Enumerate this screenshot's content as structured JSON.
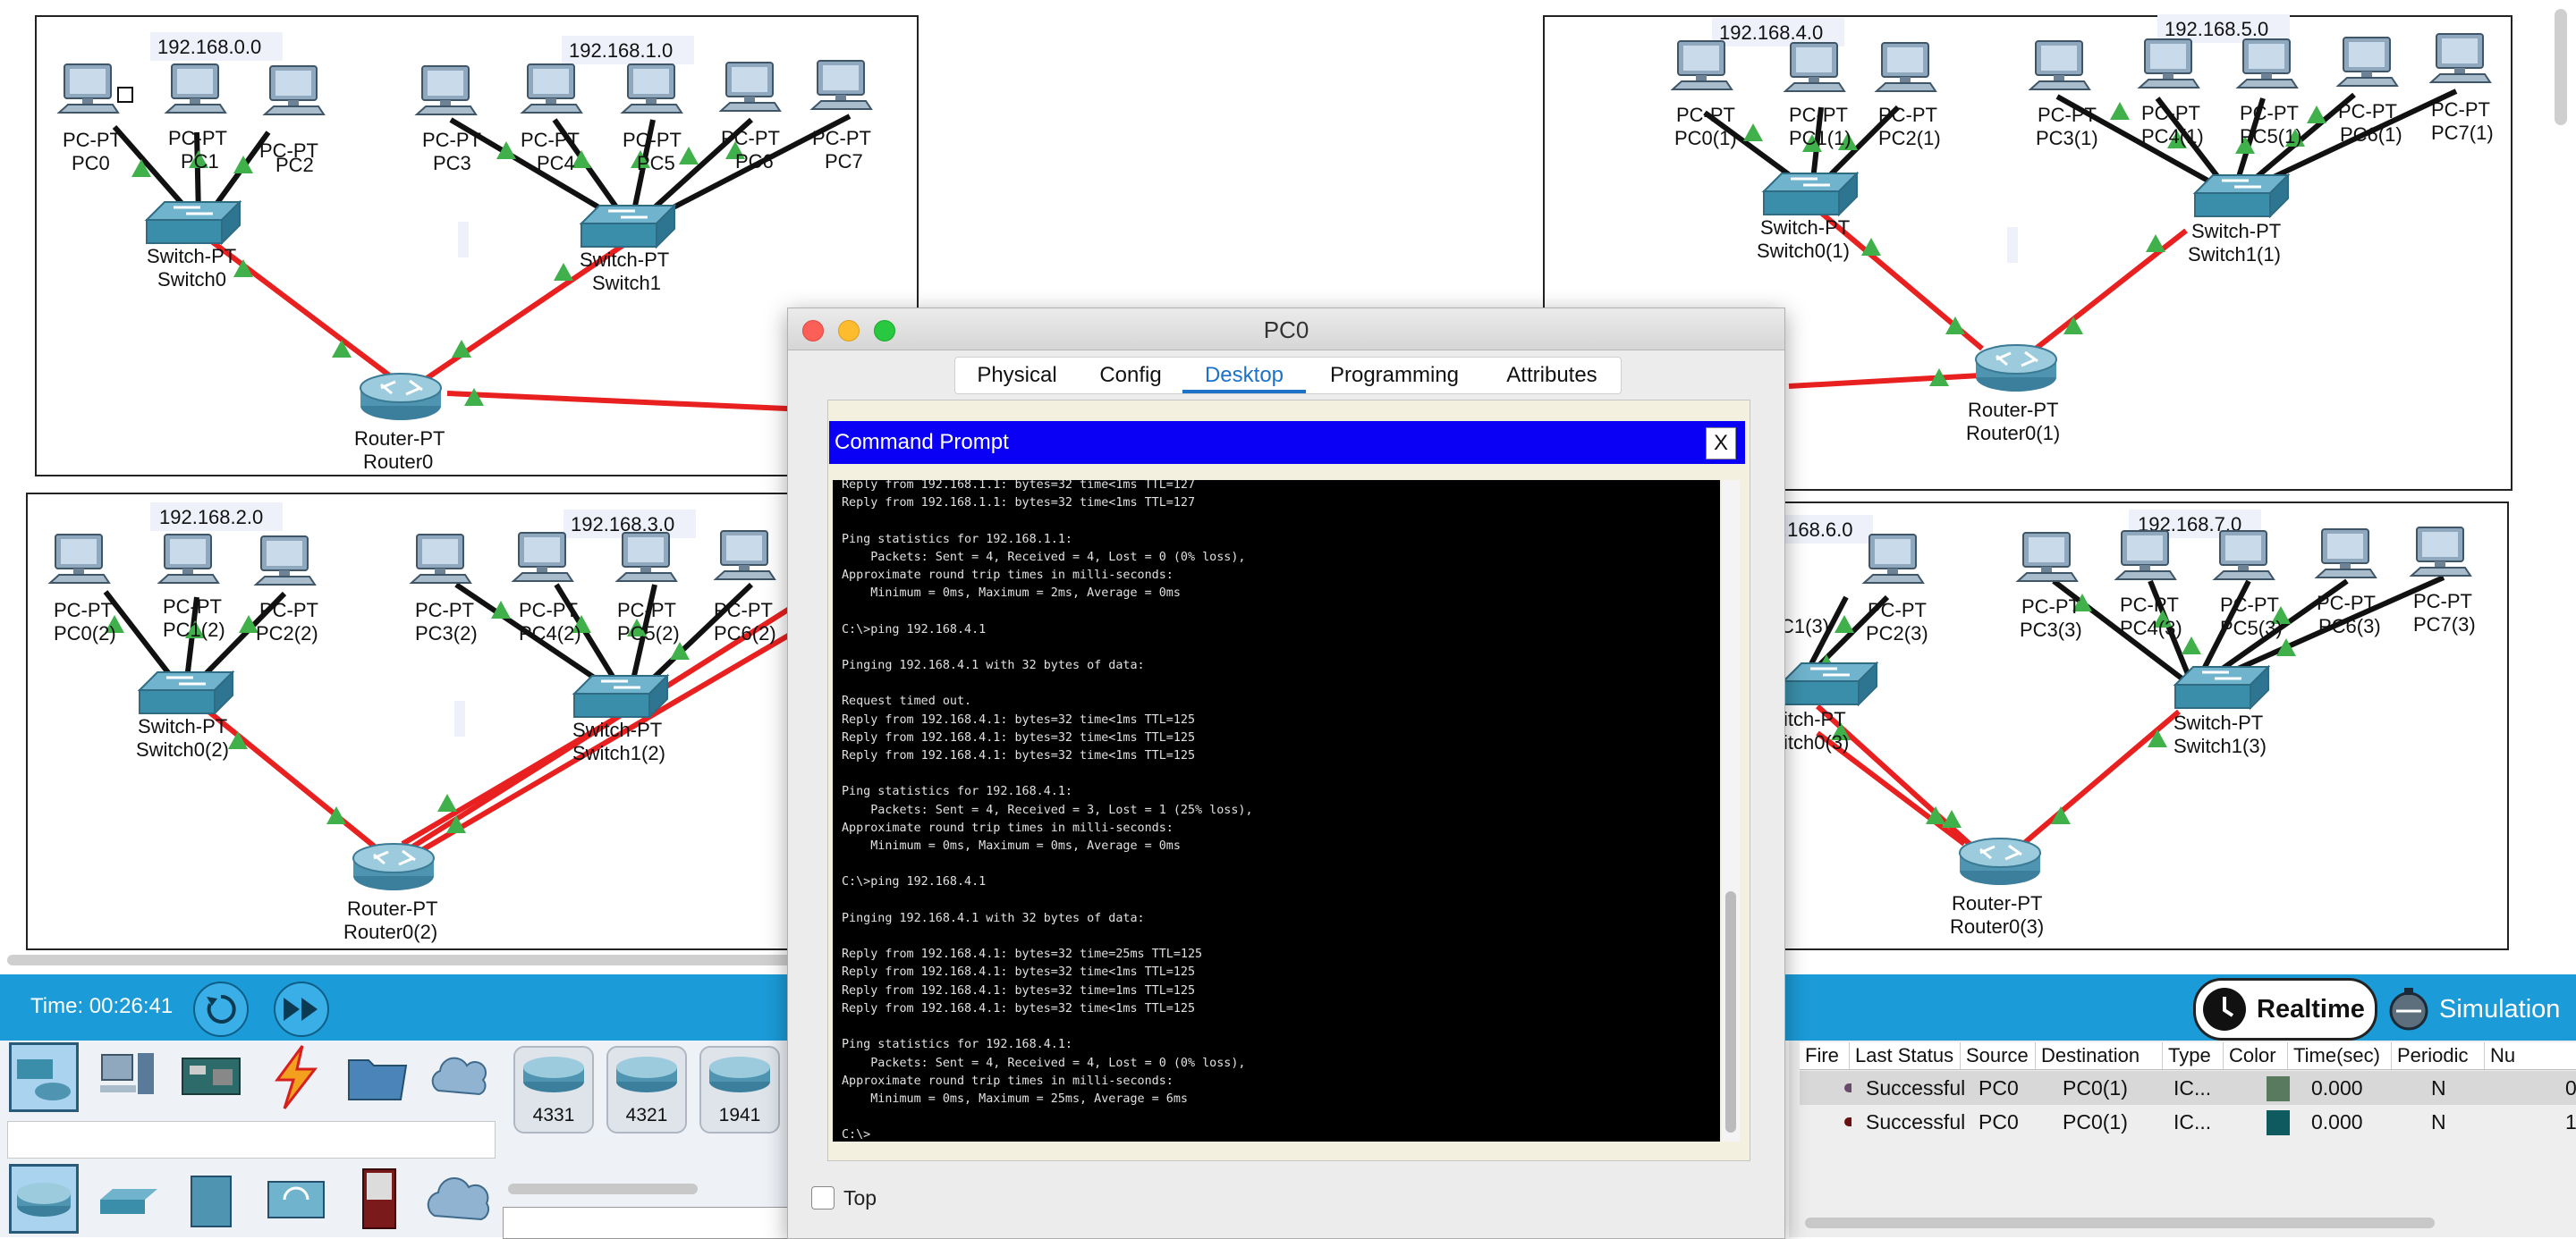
{
  "networks": {
    "n0": "192.168.0.0",
    "n1": "192.168.1.0",
    "n2": "192.168.2.0",
    "n3": "192.168.3.0",
    "n4": "192.168.4.0",
    "n5": "192.168.5.0",
    "n6": ".168.6.0",
    "n7": "192.168.7.0"
  },
  "device_type": {
    "pc": "PC-PT",
    "switch": "Switch-PT",
    "router": "Router-PT"
  },
  "devices": {
    "a": {
      "pcs": [
        "PC0",
        "PC1",
        "PC2",
        "PC3",
        "PC4",
        "PC5",
        "PC6",
        "PC7"
      ],
      "switch0": "Switch0",
      "switch1": "Switch1",
      "router": "Router0"
    },
    "b": {
      "pcs": [
        "PC0(1)",
        "PC1(1)",
        "PC2(1)",
        "PC3(1)",
        "PC4(1)",
        "PC5(1)",
        "PC6(1)",
        "PC7(1)"
      ],
      "switch0": "Switch0(1)",
      "switch1": "Switch1(1)",
      "router": "Router0(1)"
    },
    "c": {
      "pcs": [
        "PC0(2)",
        "PC1(2)",
        "PC2(2)",
        "PC3(2)",
        "PC4(2)",
        "PC5(2)",
        "PC6(2)"
      ],
      "switch0": "Switch0(2)",
      "switch1": "Switch1(2)",
      "router": "Router0(2)"
    },
    "d": {
      "pcs": [
        "C1(3)",
        "PC2(3)",
        "PC3(3)",
        "PC4(3)",
        "PC5(3)",
        "PC6(3)",
        "PC7(3)"
      ],
      "switch0": "itch0(3)",
      "switch1": "Switch1(3)",
      "router": "Router0(3)",
      "switch0_type": "itch-PT"
    }
  },
  "window": {
    "title": "PC0",
    "tabs": [
      "Physical",
      "Config",
      "Desktop",
      "Programming",
      "Attributes"
    ],
    "active_tab": "Desktop",
    "top_checkbox_label": "Top"
  },
  "command_prompt": {
    "title": "Command Prompt",
    "close_label": "X",
    "output": "Reply from 192.168.1.1: bytes=32 time<1ms TTL=127\nReply from 192.168.1.1: bytes=32 time<1ms TTL=127\n\nPing statistics for 192.168.1.1:\n    Packets: Sent = 4, Received = 4, Lost = 0 (0% loss),\nApproximate round trip times in milli-seconds:\n    Minimum = 0ms, Maximum = 2ms, Average = 0ms\n\nC:\\>ping 192.168.4.1\n\nPinging 192.168.4.1 with 32 bytes of data:\n\nRequest timed out.\nReply from 192.168.4.1: bytes=32 time<1ms TTL=125\nReply from 192.168.4.1: bytes=32 time<1ms TTL=125\nReply from 192.168.4.1: bytes=32 time<1ms TTL=125\n\nPing statistics for 192.168.4.1:\n    Packets: Sent = 4, Received = 3, Lost = 1 (25% loss),\nApproximate round trip times in milli-seconds:\n    Minimum = 0ms, Maximum = 0ms, Average = 0ms\n\nC:\\>ping 192.168.4.1\n\nPinging 192.168.4.1 with 32 bytes of data:\n\nReply from 192.168.4.1: bytes=32 time=25ms TTL=125\nReply from 192.168.4.1: bytes=32 time<1ms TTL=125\nReply from 192.168.4.1: bytes=32 time=1ms TTL=125\nReply from 192.168.4.1: bytes=32 time<1ms TTL=125\n\nPing statistics for 192.168.4.1:\n    Packets: Sent = 4, Received = 4, Lost = 0 (0% loss),\nApproximate round trip times in milli-seconds:\n    Minimum = 0ms, Maximum = 25ms, Average = 6ms\n\nC:\\>"
  },
  "simulation_bar": {
    "time": "Time: 00:26:41",
    "realtime_label": "Realtime",
    "simulation_label": "Simulation"
  },
  "device_models": [
    "4331",
    "4321",
    "1941"
  ],
  "event_list": {
    "columns": [
      "Fire",
      "Last Status",
      "Source",
      "Destination",
      "Type",
      "Color",
      "Time(sec)",
      "Periodic",
      "Nu"
    ],
    "rows": [
      {
        "status": "Successful",
        "source": "PC0",
        "destination": "PC0(1)",
        "type": "IC...",
        "color": "#5a7a60",
        "time": "0.000",
        "periodic": "N",
        "num": "0"
      },
      {
        "status": "Successful",
        "source": "PC0",
        "destination": "PC0(1)",
        "type": "IC...",
        "color": "#0e5a5e",
        "time": "0.000",
        "periodic": "N",
        "num": "1"
      }
    ]
  },
  "colors": {
    "link_red": "#e82020",
    "link_black": "#111111",
    "port_green": "#3fb04a",
    "toolbar_blue": "#1b9bd7",
    "cmd_blue": "#0a00f5"
  }
}
